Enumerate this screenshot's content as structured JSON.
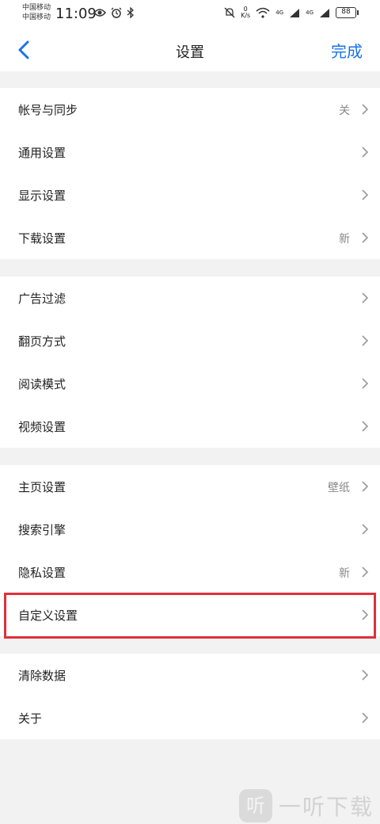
{
  "status_bar": {
    "carrier1": "中国移动",
    "carrier2": "中国移动",
    "time": "11:09",
    "net_speed_value": "0",
    "net_speed_unit": "K/s",
    "sig1_label": "4G",
    "sig2_label": "4G",
    "battery": "88"
  },
  "nav": {
    "title": "设置",
    "done_label": "完成"
  },
  "groups": [
    {
      "items": [
        {
          "label": "帐号与同步",
          "value": "关"
        },
        {
          "label": "通用设置",
          "value": ""
        },
        {
          "label": "显示设置",
          "value": ""
        },
        {
          "label": "下载设置",
          "value": "新"
        }
      ]
    },
    {
      "items": [
        {
          "label": "广告过滤",
          "value": ""
        },
        {
          "label": "翻页方式",
          "value": ""
        },
        {
          "label": "阅读模式",
          "value": ""
        },
        {
          "label": "视频设置",
          "value": ""
        }
      ]
    },
    {
      "items": [
        {
          "label": "主页设置",
          "value": "壁纸"
        },
        {
          "label": "搜索引擎",
          "value": ""
        },
        {
          "label": "隐私设置",
          "value": "新"
        },
        {
          "label": "自定义设置",
          "value": ""
        }
      ]
    },
    {
      "items": [
        {
          "label": "清除数据",
          "value": ""
        },
        {
          "label": "关于",
          "value": ""
        }
      ]
    }
  ],
  "highlighted_item": "自定义设置",
  "watermark": {
    "badge": "听",
    "text": "一听下载"
  },
  "colors": {
    "accent": "#1a73e8",
    "highlight": "#e0303a",
    "background": "#f2f2f3"
  }
}
